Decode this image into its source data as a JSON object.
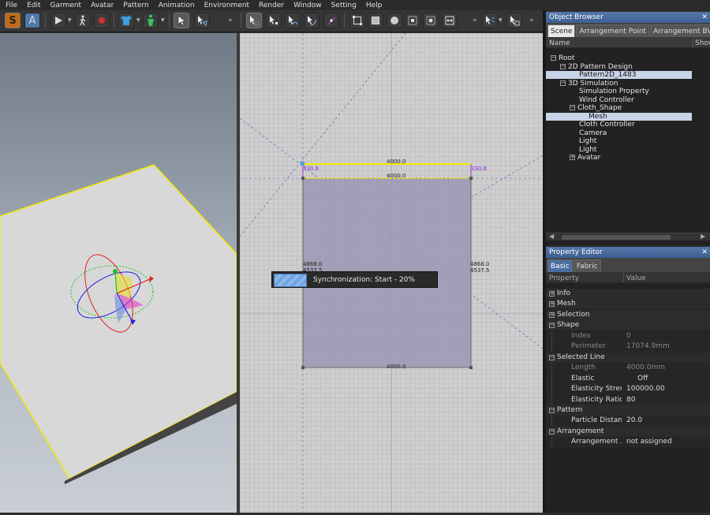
{
  "menu": [
    "File",
    "Edit",
    "Garment",
    "Avatar",
    "Pattern",
    "Animation",
    "Environment",
    "Render",
    "Window",
    "Setting",
    "Help"
  ],
  "toolbar_left": {
    "s_label": "S",
    "a_label": "A"
  },
  "viewport2d": {
    "top_length_label": "4000.0",
    "top_inner_label": "4000.0",
    "bottom_length_label": "4000.0",
    "left_label_a": "330.6",
    "right_label_a": "330.6",
    "left_dims_1": "4868.0",
    "left_dims_2": "4537.5",
    "right_dims_1": "4868.0",
    "right_dims_2": "4537.5",
    "sync_text": "Synchronization: Start - 20%",
    "sync_progress": 0.2
  },
  "object_browser": {
    "title": "Object Browser",
    "tabs": [
      "Scene",
      "Arrangement Point",
      "Arrangement BV"
    ],
    "col_name": "Name",
    "col_show": "Show",
    "tree": [
      {
        "label": "Root",
        "depth": 0,
        "toggle": "−",
        "selected": false
      },
      {
        "label": "2D Pattern Design",
        "depth": 1,
        "toggle": "−",
        "selected": false
      },
      {
        "label": "Pattern2D_1483",
        "depth": 3,
        "toggle": "",
        "selected": true
      },
      {
        "label": "3D Simulation",
        "depth": 1,
        "toggle": "−",
        "selected": false
      },
      {
        "label": "Simulation Property",
        "depth": 3,
        "toggle": "",
        "selected": false
      },
      {
        "label": "Wind Controller",
        "depth": 3,
        "toggle": "",
        "selected": false
      },
      {
        "label": "Cloth_Shape",
        "depth": 2,
        "toggle": "−",
        "selected": false
      },
      {
        "label": "Mesh",
        "depth": 4,
        "toggle": "",
        "selected": true
      },
      {
        "label": "Cloth Controller",
        "depth": 3,
        "toggle": "",
        "selected": false
      },
      {
        "label": "Camera",
        "depth": 3,
        "toggle": "",
        "selected": false
      },
      {
        "label": "Light",
        "depth": 3,
        "toggle": "",
        "selected": false
      },
      {
        "label": "Light",
        "depth": 3,
        "toggle": "",
        "selected": false
      },
      {
        "label": "Avatar",
        "depth": 2,
        "toggle": "+",
        "selected": false
      }
    ]
  },
  "property_editor": {
    "title": "Property Editor",
    "tabs": [
      "Basic",
      "Fabric"
    ],
    "col_property": "Property",
    "col_value": "Value",
    "rows": [
      {
        "type": "cat",
        "toggle": "+",
        "key": "Info",
        "val": ""
      },
      {
        "type": "cat",
        "toggle": "+",
        "key": "Mesh",
        "val": ""
      },
      {
        "type": "cat",
        "toggle": "+",
        "key": "Selection",
        "val": ""
      },
      {
        "type": "cat",
        "toggle": "−",
        "key": "Shape",
        "val": ""
      },
      {
        "type": "prop",
        "key": "Index",
        "val": "0",
        "dim": true
      },
      {
        "type": "prop",
        "key": "Perimeter",
        "val": "17074.9mm",
        "dim": true
      },
      {
        "type": "cat",
        "toggle": "−",
        "key": "Selected Line",
        "val": ""
      },
      {
        "type": "prop",
        "key": "Length",
        "val": "4000.0mm",
        "dim": true
      },
      {
        "type": "prop",
        "key": "Elastic",
        "val": "Off",
        "dim": false,
        "centered": true
      },
      {
        "type": "prop",
        "key": "Elasticity Stren...",
        "val": "100000.00",
        "dim": false
      },
      {
        "type": "prop",
        "key": "Elasticity Ratio",
        "val": "80",
        "dim": false
      },
      {
        "type": "cat",
        "toggle": "−",
        "key": "Pattern",
        "val": ""
      },
      {
        "type": "prop",
        "key": "Particle Distance",
        "val": "20.0",
        "dim": false
      },
      {
        "type": "cat",
        "toggle": "−",
        "key": "Arrangement",
        "val": ""
      },
      {
        "type": "prop",
        "key": "Arrangement ...",
        "val": "not assigned",
        "dim": false
      }
    ]
  },
  "colors": {
    "accent_title": "#4a6ea0",
    "pattern_fill": "#9a98b4",
    "seam_yellow": "#f2e800",
    "axis_red": "#e02020",
    "axis_green": "#20c020",
    "axis_blue": "#2020e0"
  }
}
